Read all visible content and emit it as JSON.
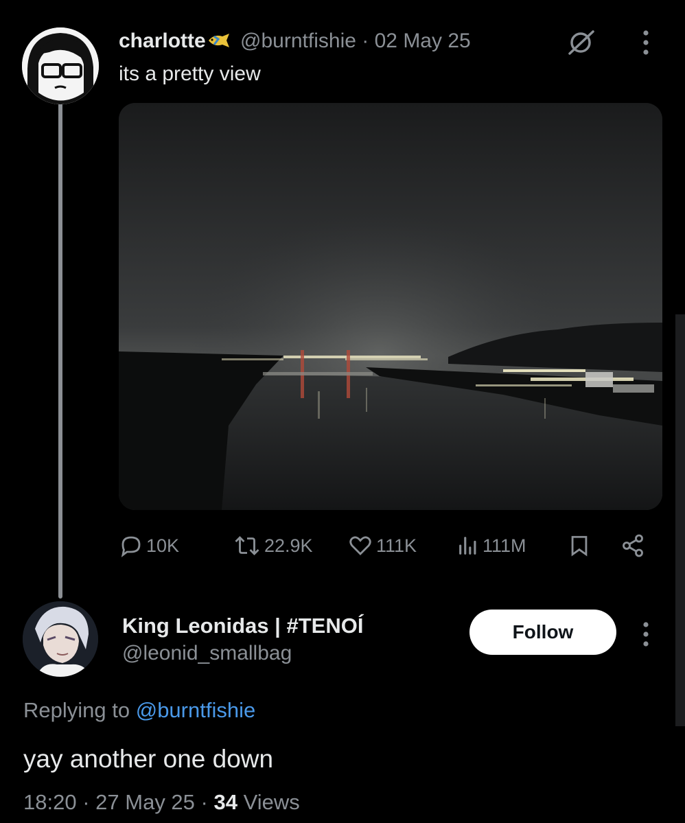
{
  "tweet": {
    "author_name": "charlotte",
    "author_badge": "fish-emoji",
    "handle": "@burntfishie",
    "separator": "·",
    "date": "02 May 25",
    "text": "its a pretty view",
    "image_alt": "night view over a river with city lights",
    "stats": {
      "replies": "10K",
      "reposts": "22.9K",
      "likes": "111K",
      "views": "111M"
    }
  },
  "reply": {
    "author_name": "King Leonidas | #TENOÍ",
    "handle": "@leonid_smallbag",
    "follow_label": "Follow",
    "replying_prefix": "Replying to",
    "replying_to": "@burntfishie",
    "text": "yay another one down",
    "time": "18:20",
    "separator": "·",
    "date": "27 May 25",
    "views_count": "34",
    "views_label": "Views"
  },
  "colors": {
    "background": "#000000",
    "text": "#e7e9ea",
    "muted": "#8b9096",
    "mention": "#4a99e9",
    "follow_bg": "#ffffff"
  },
  "icons": [
    "grok-icon",
    "more-icon",
    "reply-icon",
    "repost-icon",
    "like-icon",
    "views-icon",
    "bookmark-icon",
    "share-icon"
  ]
}
